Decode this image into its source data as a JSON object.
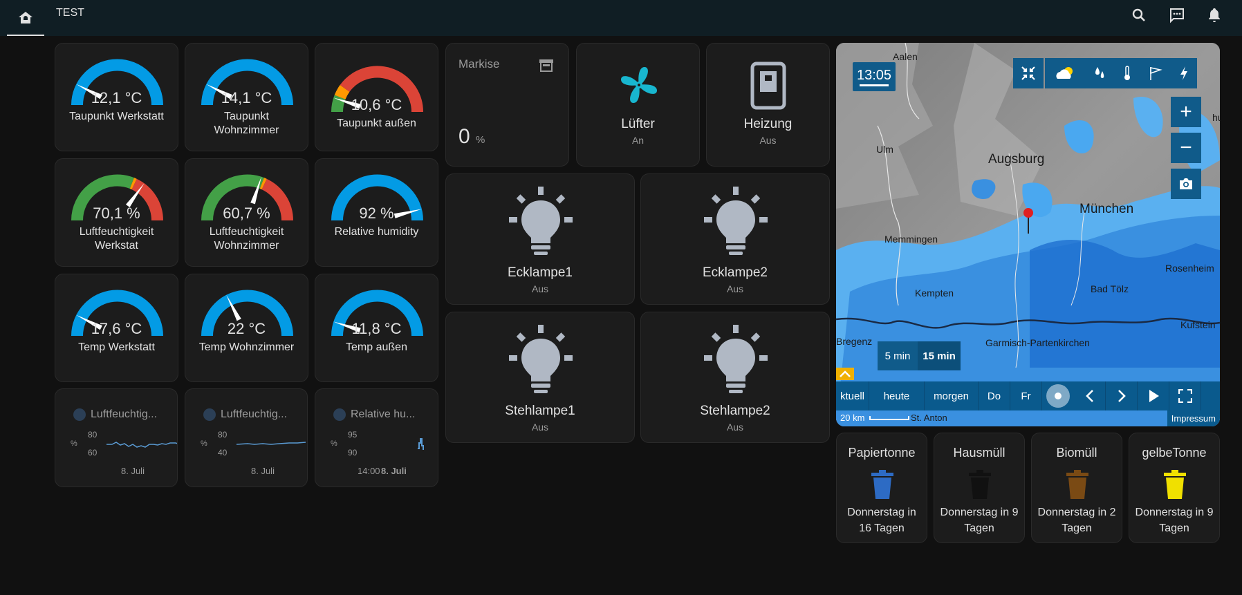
{
  "header": {
    "tab_label": "TEST",
    "icons": [
      "home-icon",
      "search-icon",
      "chat-icon",
      "bell-icon"
    ]
  },
  "gauges": [
    {
      "value": "12,1 °C",
      "name": "Taupunkt Werkstatt",
      "fraction": 0.15,
      "style": "blue"
    },
    {
      "value": "14,1 °C",
      "name": "Taupunkt Wohnzimmer",
      "fraction": 0.15,
      "style": "blue"
    },
    {
      "value": "10,6 °C",
      "name": "Taupunkt außen",
      "fraction": 0.1,
      "style": "tricolor"
    },
    {
      "value": "70,1 %",
      "name": "Luftfeuchtigkeit Werkstat",
      "fraction": 0.7,
      "style": "greenred"
    },
    {
      "value": "60,7 %",
      "name": "Luftfeuchtigkeit Wohnzimmer",
      "fraction": 0.6,
      "style": "greenred"
    },
    {
      "value": "92 %",
      "name": "Relative humidity",
      "fraction": 0.92,
      "style": "blue"
    },
    {
      "value": "17,6 °C",
      "name": "Temp Werkstatt",
      "fraction": 0.15,
      "style": "blue"
    },
    {
      "value": "22 °C",
      "name": "Temp Wohnzimmer",
      "fraction": 0.35,
      "style": "blue"
    },
    {
      "value": "11,8 °C",
      "name": "Temp außen",
      "fraction": 0.1,
      "style": "blue"
    }
  ],
  "sensor_graphs": [
    {
      "name": "Luftfeuchtig...",
      "y_ticks": [
        "80",
        "60"
      ],
      "x_label": "8. Juli"
    },
    {
      "name": "Luftfeuchtig...",
      "y_ticks": [
        "80",
        "40"
      ],
      "x_label": "8. Juli"
    },
    {
      "name": "Relative hu...",
      "y_ticks": [
        "95",
        "90"
      ],
      "x_label": "14:00",
      "x_label2": "8. Juli"
    }
  ],
  "markise": {
    "title": "Markise",
    "value": "0",
    "unit": "%"
  },
  "tiles": [
    {
      "title": "Lüfter",
      "state": "An",
      "icon": "fan-icon"
    },
    {
      "title": "Heizung",
      "state": "Aus",
      "icon": "radiator-icon"
    },
    {
      "title": "Ecklampe1",
      "state": "Aus",
      "icon": "lightbulb-icon"
    },
    {
      "title": "Ecklampe2",
      "state": "Aus",
      "icon": "lightbulb-icon"
    },
    {
      "title": "Stehlampe1",
      "state": "Aus",
      "icon": "lightbulb-icon"
    },
    {
      "title": "Stehlampe2",
      "state": "Aus",
      "icon": "lightbulb-icon"
    }
  ],
  "map": {
    "time": "13:05",
    "places": [
      "Aalen",
      "Ulm",
      "Augsburg",
      "München",
      "Memmingen",
      "Kempten",
      "Bad Tölz",
      "Rosenheim",
      "Kufstein",
      "Bregenz",
      "Garmisch-Partenkirchen",
      "St. Anton",
      "hut"
    ],
    "interval_options": [
      "5 min",
      "15 min"
    ],
    "timeline": [
      "ktuell",
      "heute",
      "morgen",
      "Do",
      "Fr"
    ],
    "scale": "20 km",
    "credit": "Impressum",
    "colors": {
      "rain_light": "#5ab0f0",
      "rain_dark": "#1e6fd0",
      "ui": "#105b8a",
      "marker": "#e02020"
    }
  },
  "trash": [
    {
      "name": "Papiertonne",
      "info": "Donnerstag in 16 Tagen",
      "color": "#2d6bc4"
    },
    {
      "name": "Hausmüll",
      "info": "Donnerstag in 9 Tagen",
      "color": "#111111"
    },
    {
      "name": "Biomüll",
      "info": "Donnerstag in 2 Tagen",
      "color": "#7a4a14"
    },
    {
      "name": "gelbeTonne",
      "info": "Donnerstag in 9 Tagen",
      "color": "#f0e000"
    }
  ]
}
